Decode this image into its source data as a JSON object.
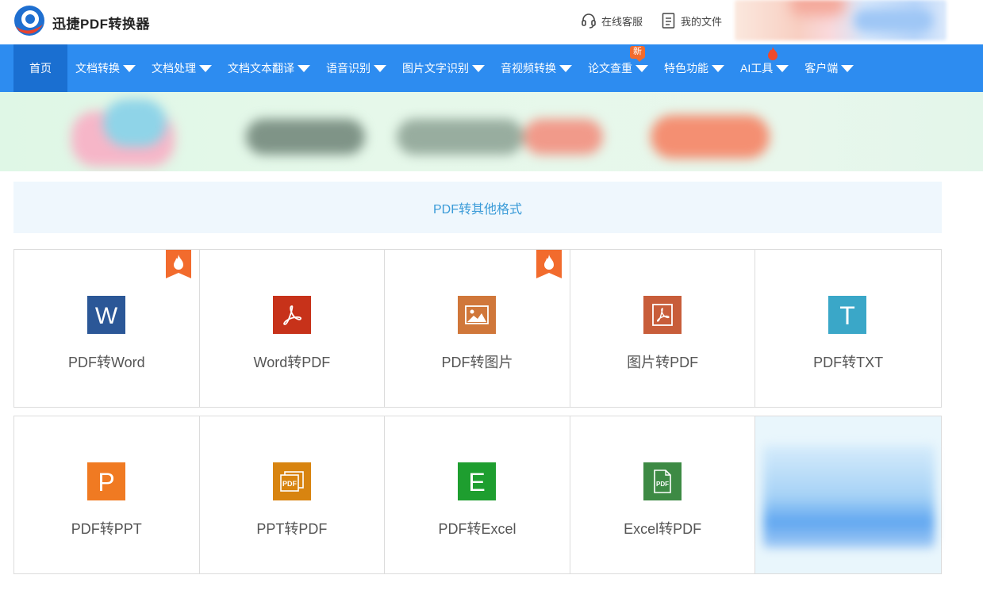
{
  "header": {
    "brand": "迅捷PDF转换器",
    "service_label": "在线客服",
    "files_label": "我的文件"
  },
  "nav": {
    "items": [
      {
        "label": "首页"
      },
      {
        "label": "文档转换"
      },
      {
        "label": "文档处理"
      },
      {
        "label": "文档文本翻译"
      },
      {
        "label": "语音识别"
      },
      {
        "label": "图片文字识别"
      },
      {
        "label": "音视频转换"
      },
      {
        "label": "论文查重",
        "badge": "新"
      },
      {
        "label": "特色功能"
      },
      {
        "label": "AI工具"
      },
      {
        "label": "客户端"
      }
    ]
  },
  "section": {
    "title": "PDF转其他格式"
  },
  "tools": {
    "row1": [
      {
        "label": "PDF转Word",
        "icon": "word-icon",
        "color": "#2b5797",
        "hot": true
      },
      {
        "label": "Word转PDF",
        "icon": "acrobat-icon",
        "color": "#c7321a",
        "hot": false
      },
      {
        "label": "PDF转图片",
        "icon": "image-icon",
        "color": "#d0773a",
        "hot": true
      },
      {
        "label": "图片转PDF",
        "icon": "pdf-document-icon",
        "color": "#c85d3a",
        "hot": false
      },
      {
        "label": "PDF转TXT",
        "icon": "text-icon",
        "color": "#3aa7c8",
        "hot": false
      }
    ],
    "row2": [
      {
        "label": "PDF转PPT",
        "icon": "ppt-icon",
        "color": "#f07a22"
      },
      {
        "label": "PPT转PDF",
        "icon": "ppt-pdf-icon",
        "color": "#d88410"
      },
      {
        "label": "PDF转Excel",
        "icon": "excel-icon",
        "color": "#1e9e2f"
      },
      {
        "label": "Excel转PDF",
        "icon": "excel-pdf-icon",
        "color": "#3d8a44"
      }
    ]
  },
  "colors": {
    "nav_bg": "#2d8cf0",
    "nav_active": "#1a6fd1",
    "section_text": "#3a9bd8",
    "hot": "#f26b2d"
  }
}
